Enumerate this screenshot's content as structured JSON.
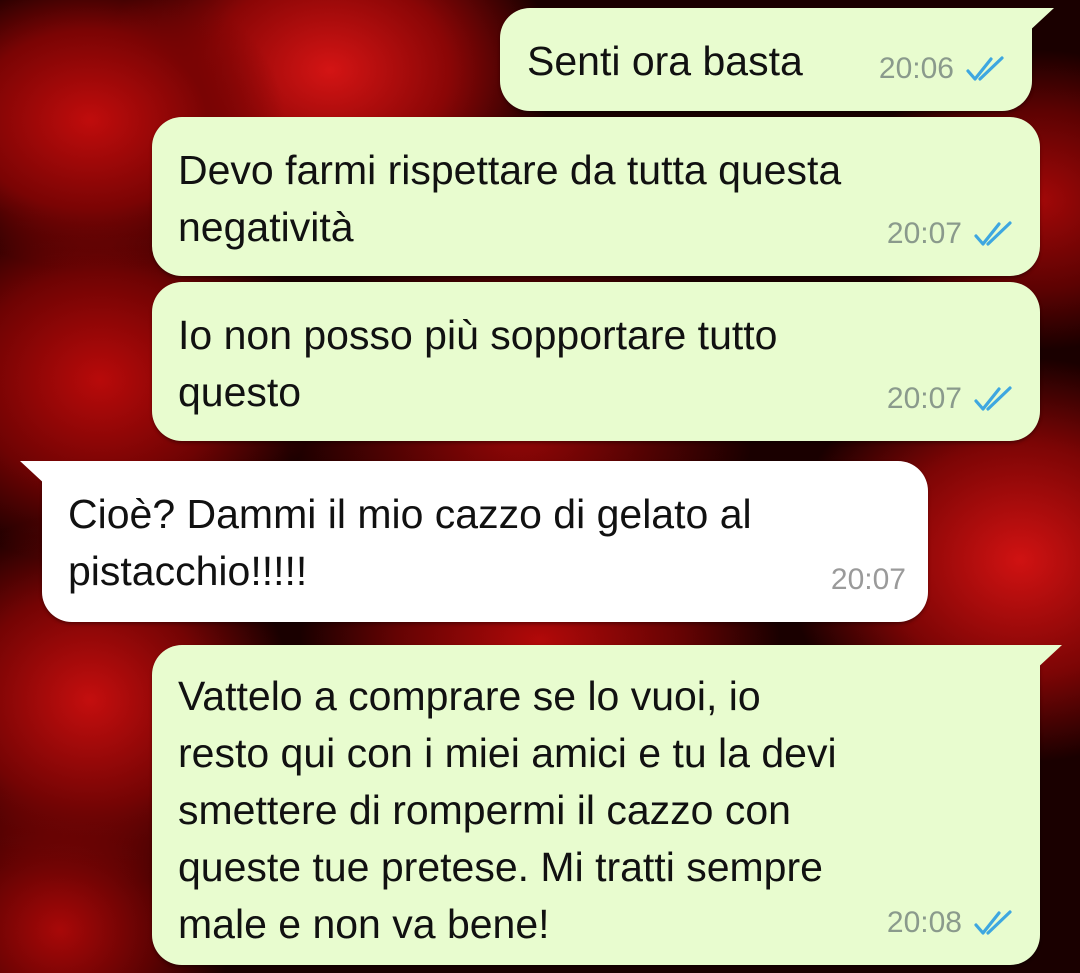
{
  "colors": {
    "outgoing_bubble": "#e8fccf",
    "incoming_bubble": "#ffffff",
    "read_ticks": "#3ea7e0",
    "timestamp": "#8a9a8c"
  },
  "messages": [
    {
      "direction": "outgoing",
      "text": "Senti ora basta",
      "time": "20:06",
      "status_icon": "double-check-read-icon"
    },
    {
      "direction": "outgoing",
      "text": "Devo farmi rispettare da tutta questa\nnegatività",
      "time": "20:07",
      "status_icon": "double-check-read-icon"
    },
    {
      "direction": "outgoing",
      "text": "Io non posso più sopportare tutto\nquesto",
      "time": "20:07",
      "status_icon": "double-check-read-icon"
    },
    {
      "direction": "incoming",
      "text": "Cioè? Dammi il mio cazzo di gelato al\npistacchio!!!!!",
      "time": "20:07"
    },
    {
      "direction": "outgoing",
      "text": "Vattelo a comprare se lo vuoi, io\nresto qui con i miei amici e tu la devi\nsmettere di rompermi il cazzo con\nqueste tue pretese. Mi tratti sempre\nmale e non va bene!",
      "time": "20:08",
      "status_icon": "double-check-read-icon"
    }
  ]
}
